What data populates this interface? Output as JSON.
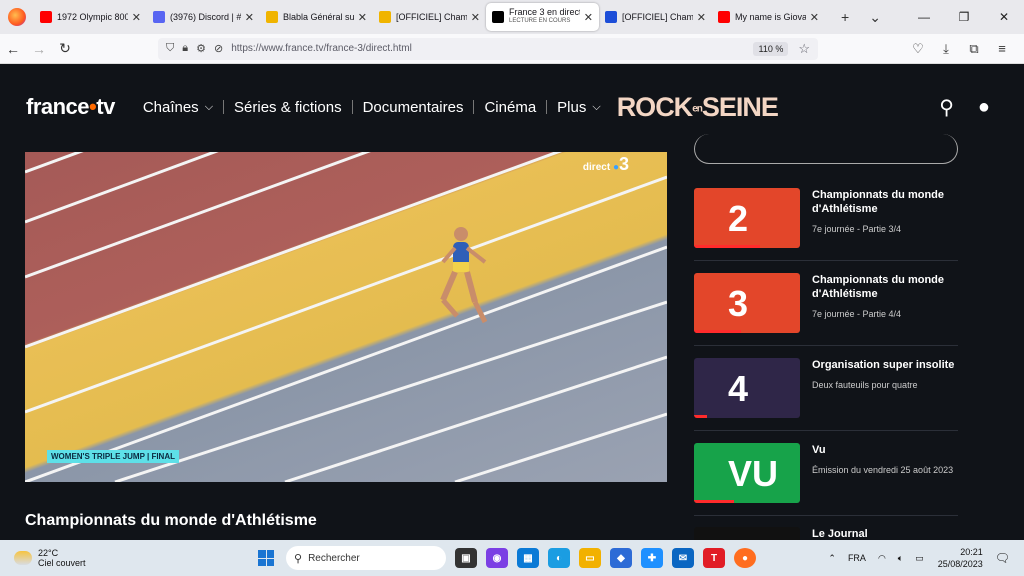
{
  "browser": {
    "tabs": [
      {
        "title": "1972 Olympic 800",
        "favicon_color": "#ff0000",
        "favicon": "youtube-icon"
      },
      {
        "title": "(3976) Discord | #",
        "favicon_color": "#5865f2",
        "favicon": "discord-icon"
      },
      {
        "title": "Blabla Général sur",
        "favicon_color": "#f0b400",
        "favicon": "jvc-icon"
      },
      {
        "title": "[OFFICIEL] Champ",
        "favicon_color": "#f0b400",
        "favicon": "jvc-icon"
      },
      {
        "title": "France 3 en direct",
        "subtitle": "LECTURE EN COURS",
        "favicon_color": "#000000",
        "favicon": "france-tv-icon",
        "active": true
      },
      {
        "title": "[OFFICIEL] Champ",
        "favicon_color": "#1d4ed8",
        "favicon": "jv-icon"
      },
      {
        "title": "My name is Giova",
        "favicon_color": "#ff0000",
        "favicon": "youtube-icon"
      }
    ],
    "url": "https://www.france.tv/france-3/direct.html",
    "zoom": "110 %"
  },
  "site": {
    "logo_main": "france",
    "logo_dot": "•",
    "logo_tv": "tv",
    "menu": [
      "Chaînes",
      "Séries & fictions",
      "Documentaires",
      "Cinéma",
      "Plus"
    ],
    "promo": "ROCK",
    "promo_small": "en",
    "promo_end": "SEINE",
    "player": {
      "channel_label": "direct",
      "channel_num": "3",
      "caption": "WOMEN'S TRIPLE JUMP | FINAL"
    },
    "video_title": "Championnats du monde d'Athlétisme",
    "cards": [
      {
        "num": "2",
        "title": "Championnats du monde d'Athlétisme",
        "subtitle": "7e journée - Partie 3/4",
        "bg": "#e3462a",
        "progress": 0.62
      },
      {
        "num": "3",
        "title": "Championnats du monde d'Athlétisme",
        "subtitle": "7e journée - Partie 4/4",
        "bg": "#e3462a",
        "progress": 0.44
      },
      {
        "num": "4",
        "title": "Organisation super insolite",
        "subtitle": "Deux fauteuils pour quatre",
        "bg": "#2f2648",
        "progress": 0.12
      },
      {
        "num": "VU",
        "title": "Vu",
        "subtitle": "Émission du vendredi 25 août 2023",
        "bg": "#17a34a",
        "progress": 0.38
      },
      {
        "num": "",
        "title": "Le Journal",
        "subtitle": "",
        "bg": "#111111",
        "progress": 0
      }
    ]
  },
  "taskbar": {
    "temp": "22°C",
    "weather": "Ciel couvert",
    "search_placeholder": "Rechercher",
    "lang": "FRA",
    "time": "20:21",
    "date": "25/08/2023"
  }
}
